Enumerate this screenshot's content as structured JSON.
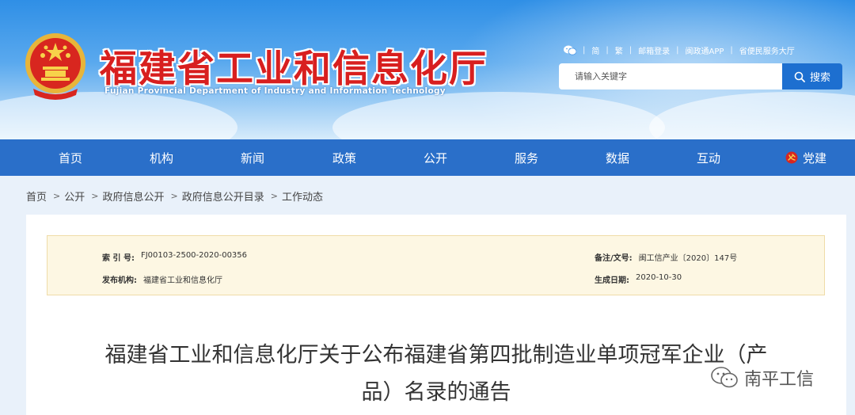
{
  "header": {
    "site_title": "福建省工业和信息化厅",
    "site_subtitle": "Fujian Provincial Department of Industry and Information Technology",
    "toplinks": [
      "简",
      "繁",
      "邮箱登录",
      "闽政通APP",
      "省便民服务大厅"
    ],
    "search": {
      "placeholder": "请输入关键字",
      "button_label": "搜索"
    }
  },
  "nav": {
    "items": [
      "首页",
      "机构",
      "新闻",
      "政策",
      "公开",
      "服务",
      "数据",
      "互动",
      "党建"
    ]
  },
  "breadcrumb": [
    "首页",
    "公开",
    "政府信息公开",
    "政府信息公开目录",
    "工作动态"
  ],
  "meta": {
    "index_label": "索 引 号:",
    "index_value": "FJ00103-2500-2020-00356",
    "docno_label": "备注/文号:",
    "docno_value": "闽工信产业〔2020〕147号",
    "publisher_label": "发布机构:",
    "publisher_value": "福建省工业和信息化厅",
    "date_label": "生成日期:",
    "date_value": "2020-10-30"
  },
  "document": {
    "title_line1": "福建省工业和信息化厅关于公布福建省第四批制造业单项冠军企业（产",
    "title_line2": "品）名录的通告"
  },
  "watermark": {
    "text": "南平工信"
  },
  "colors": {
    "nav_bg": "#2a6fc9",
    "title_red": "#d81f1f",
    "search_btn": "#1d6fd0",
    "meta_bg": "#fdf7e3"
  }
}
